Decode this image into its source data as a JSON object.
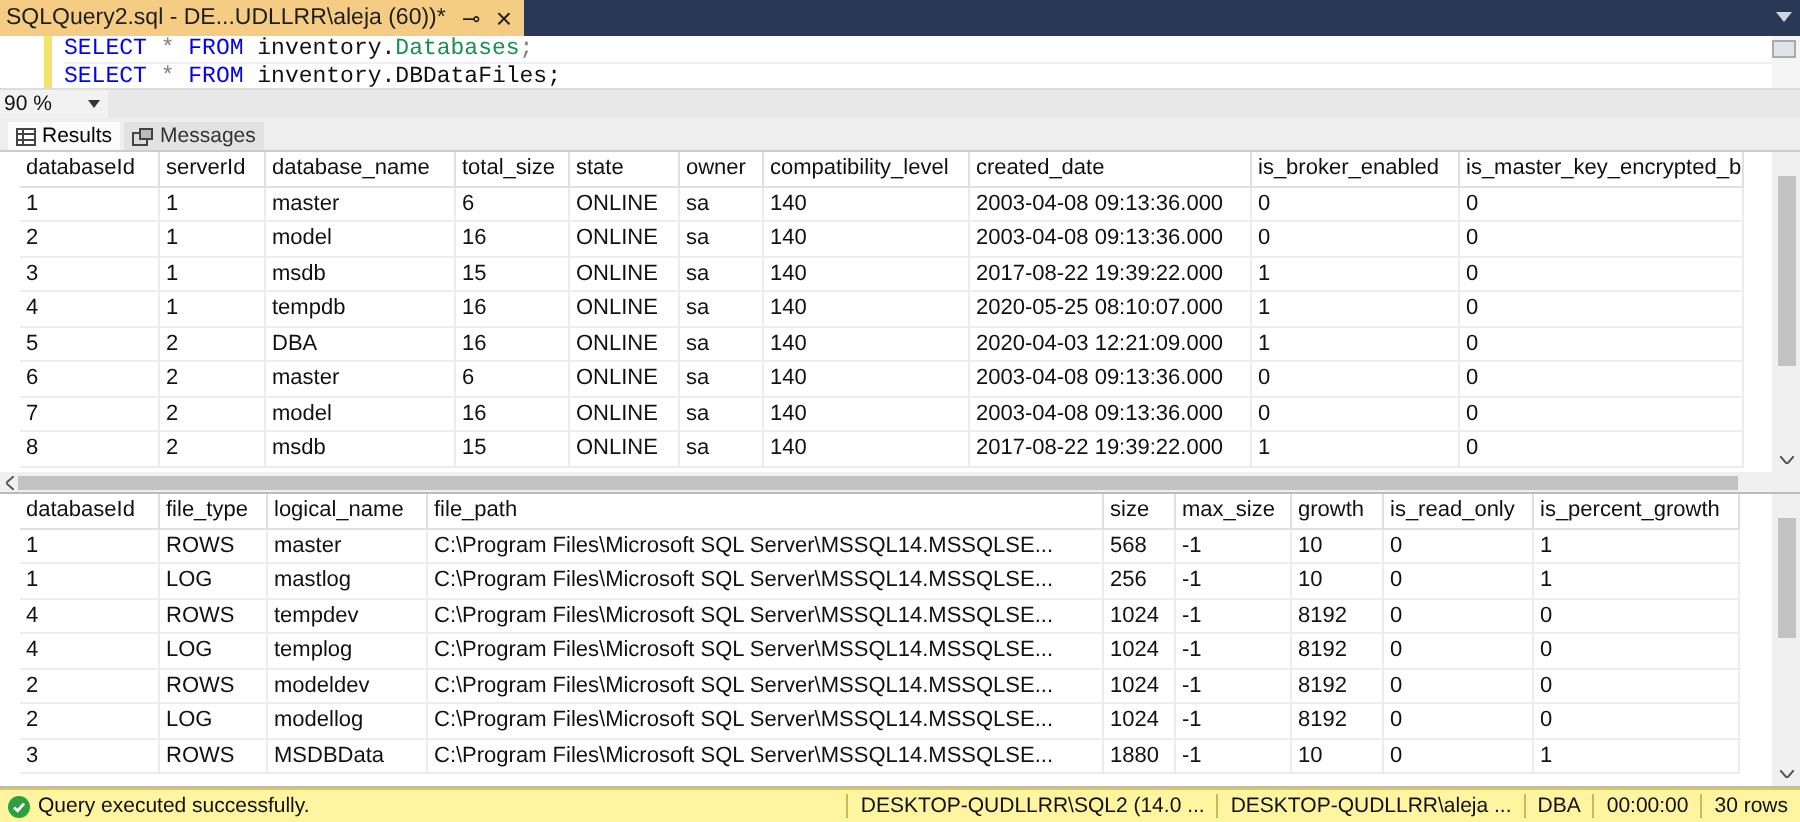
{
  "document_tab": {
    "title": "SQLQuery2.sql - DE...UDLLRR\\aleja (60))*",
    "pin": "⊸",
    "close": "×"
  },
  "editor": {
    "lines": [
      {
        "tokens": [
          {
            "text": "SELECT",
            "kind": "keyword"
          },
          {
            "text": " * ",
            "kind": "operator"
          },
          {
            "text": "FROM",
            "kind": "keyword"
          },
          {
            "text": " inventory.",
            "kind": "plain"
          },
          {
            "text": "Databases",
            "kind": "object"
          },
          {
            "text": ";",
            "kind": "operator"
          }
        ]
      },
      {
        "tokens": [
          {
            "text": "SELECT",
            "kind": "keyword"
          },
          {
            "text": " * ",
            "kind": "operator"
          },
          {
            "text": "FROM",
            "kind": "keyword"
          },
          {
            "text": " inventory.DBDataFiles;",
            "kind": "plain"
          }
        ]
      }
    ]
  },
  "zoom": {
    "value": "90 %"
  },
  "result_tabs": [
    {
      "label": "Results",
      "selected": true
    },
    {
      "label": "Messages",
      "selected": false
    }
  ],
  "grids": [
    {
      "columns": [
        {
          "label": "databaseId"
        },
        {
          "label": "serverId"
        },
        {
          "label": "database_name"
        },
        {
          "label": "total_size"
        },
        {
          "label": "state"
        },
        {
          "label": "owner"
        },
        {
          "label": "compatibility_level"
        },
        {
          "label": "created_date"
        },
        {
          "label": "is_broker_enabled"
        },
        {
          "label": "is_master_key_encrypted_b"
        }
      ],
      "rows": [
        [
          "1",
          "1",
          "master",
          "6",
          "ONLINE",
          "sa",
          "140",
          "2003-04-08 09:13:36.000",
          "0",
          "0"
        ],
        [
          "2",
          "1",
          "model",
          "16",
          "ONLINE",
          "sa",
          "140",
          "2003-04-08 09:13:36.000",
          "0",
          "0"
        ],
        [
          "3",
          "1",
          "msdb",
          "15",
          "ONLINE",
          "sa",
          "140",
          "2017-08-22 19:39:22.000",
          "1",
          "0"
        ],
        [
          "4",
          "1",
          "tempdb",
          "16",
          "ONLINE",
          "sa",
          "140",
          "2020-05-25 08:10:07.000",
          "1",
          "0"
        ],
        [
          "5",
          "2",
          "DBA",
          "16",
          "ONLINE",
          "sa",
          "140",
          "2020-04-03 12:21:09.000",
          "1",
          "0"
        ],
        [
          "6",
          "2",
          "master",
          "6",
          "ONLINE",
          "sa",
          "140",
          "2003-04-08 09:13:36.000",
          "0",
          "0"
        ],
        [
          "7",
          "2",
          "model",
          "16",
          "ONLINE",
          "sa",
          "140",
          "2003-04-08 09:13:36.000",
          "0",
          "0"
        ],
        [
          "8",
          "2",
          "msdb",
          "15",
          "ONLINE",
          "sa",
          "140",
          "2017-08-22 19:39:22.000",
          "1",
          "0"
        ]
      ]
    },
    {
      "columns": [
        {
          "label": "databaseId"
        },
        {
          "label": "file_type"
        },
        {
          "label": "logical_name"
        },
        {
          "label": "file_path"
        },
        {
          "label": "size"
        },
        {
          "label": "max_size"
        },
        {
          "label": "growth"
        },
        {
          "label": "is_read_only"
        },
        {
          "label": "is_percent_growth"
        }
      ],
      "rows": [
        [
          "1",
          "ROWS",
          "master",
          "C:\\Program Files\\Microsoft SQL Server\\MSSQL14.MSSQLSE...",
          "568",
          "-1",
          "10",
          "0",
          "1"
        ],
        [
          "1",
          "LOG",
          "mastlog",
          "C:\\Program Files\\Microsoft SQL Server\\MSSQL14.MSSQLSE...",
          "256",
          "-1",
          "10",
          "0",
          "1"
        ],
        [
          "4",
          "ROWS",
          "tempdev",
          "C:\\Program Files\\Microsoft SQL Server\\MSSQL14.MSSQLSE...",
          "1024",
          "-1",
          "8192",
          "0",
          "0"
        ],
        [
          "4",
          "LOG",
          "templog",
          "C:\\Program Files\\Microsoft SQL Server\\MSSQL14.MSSQLSE...",
          "1024",
          "-1",
          "8192",
          "0",
          "0"
        ],
        [
          "2",
          "ROWS",
          "modeldev",
          "C:\\Program Files\\Microsoft SQL Server\\MSSQL14.MSSQLSE...",
          "1024",
          "-1",
          "8192",
          "0",
          "0"
        ],
        [
          "2",
          "LOG",
          "modellog",
          "C:\\Program Files\\Microsoft SQL Server\\MSSQL14.MSSQLSE...",
          "1024",
          "-1",
          "8192",
          "0",
          "0"
        ],
        [
          "3",
          "ROWS",
          "MSDBData",
          "C:\\Program Files\\Microsoft SQL Server\\MSSQL14.MSSQLSE...",
          "1880",
          "-1",
          "10",
          "0",
          "1"
        ]
      ]
    }
  ],
  "status_bar": {
    "message": "Query executed successfully.",
    "segments": [
      "DESKTOP-QUDLLRR\\SQL2 (14.0 ...",
      "DESKTOP-QUDLLRR\\aleja ...",
      "DBA",
      "00:00:00",
      "30 rows"
    ]
  }
}
